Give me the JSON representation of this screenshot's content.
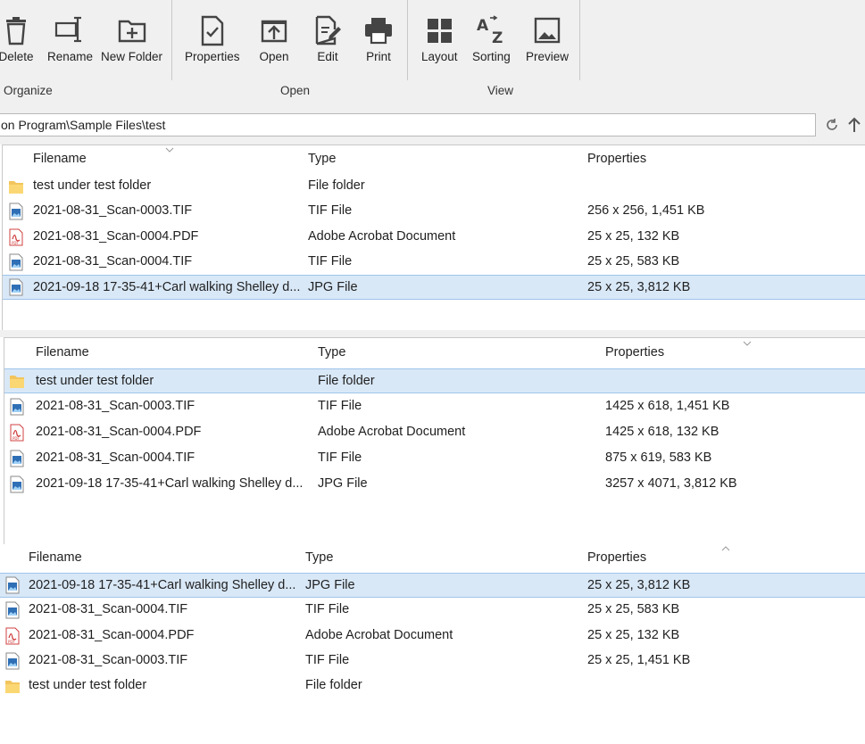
{
  "ribbon": {
    "buttons": {
      "delete": "Delete",
      "rename": "Rename",
      "new_folder": "New Folder",
      "properties": "Properties",
      "open": "Open",
      "edit": "Edit",
      "print": "Print",
      "layout": "Layout",
      "sorting": "Sorting",
      "preview": "Preview"
    },
    "groups": {
      "organize": "Organize",
      "open": "Open",
      "view": "View"
    }
  },
  "address": {
    "path": "on Program\\Sample Files\\test"
  },
  "columns": {
    "filename": "Filename",
    "type": "Type",
    "properties": "Properties"
  },
  "pane1": {
    "rows": [
      {
        "name": "test under test folder",
        "type": "File folder",
        "props": "",
        "icon": "folder"
      },
      {
        "name": "2021-08-31_Scan-0003.TIF",
        "type": "TIF File",
        "props": "256 x 256, 1,451 KB",
        "icon": "image"
      },
      {
        "name": "2021-08-31_Scan-0004.PDF",
        "type": "Adobe Acrobat Document",
        "props": "25 x 25, 132 KB",
        "icon": "pdf"
      },
      {
        "name": "2021-08-31_Scan-0004.TIF",
        "type": "TIF File",
        "props": "25 x 25, 583 KB",
        "icon": "image"
      },
      {
        "name": "2021-09-18 17-35-41+Carl walking Shelley d...",
        "type": "JPG File",
        "props": "25 x 25, 3,812 KB",
        "icon": "image",
        "selected": true
      }
    ]
  },
  "pane2": {
    "rows": [
      {
        "name": "test under test folder",
        "type": "File folder",
        "props": "",
        "icon": "folder",
        "selected": true
      },
      {
        "name": "2021-08-31_Scan-0003.TIF",
        "type": "TIF File",
        "props": "1425 x 618, 1,451 KB",
        "icon": "image"
      },
      {
        "name": "2021-08-31_Scan-0004.PDF",
        "type": "Adobe Acrobat Document",
        "props": "1425 x 618, 132 KB",
        "icon": "pdf"
      },
      {
        "name": "2021-08-31_Scan-0004.TIF",
        "type": "TIF File",
        "props": "875 x 619, 583 KB",
        "icon": "image"
      },
      {
        "name": "2021-09-18 17-35-41+Carl walking Shelley d...",
        "type": "JPG File",
        "props": "3257 x 4071, 3,812 KB",
        "icon": "image"
      }
    ]
  },
  "pane3": {
    "rows": [
      {
        "name": "2021-09-18 17-35-41+Carl walking Shelley d...",
        "type": "JPG File",
        "props": "25 x 25, 3,812 KB",
        "icon": "image",
        "selected": true
      },
      {
        "name": "2021-08-31_Scan-0004.TIF",
        "type": "TIF File",
        "props": "25 x 25, 583 KB",
        "icon": "image"
      },
      {
        "name": "2021-08-31_Scan-0004.PDF",
        "type": "Adobe Acrobat Document",
        "props": "25 x 25, 132 KB",
        "icon": "pdf"
      },
      {
        "name": "2021-08-31_Scan-0003.TIF",
        "type": "TIF File",
        "props": "25 x 25, 1,451 KB",
        "icon": "image"
      },
      {
        "name": "test under test folder",
        "type": "File folder",
        "props": "",
        "icon": "folder"
      }
    ]
  },
  "colors": {
    "selection": "#d9e8f7",
    "ribbon": "#f0f0f0",
    "icon": "#4a4a4a"
  }
}
